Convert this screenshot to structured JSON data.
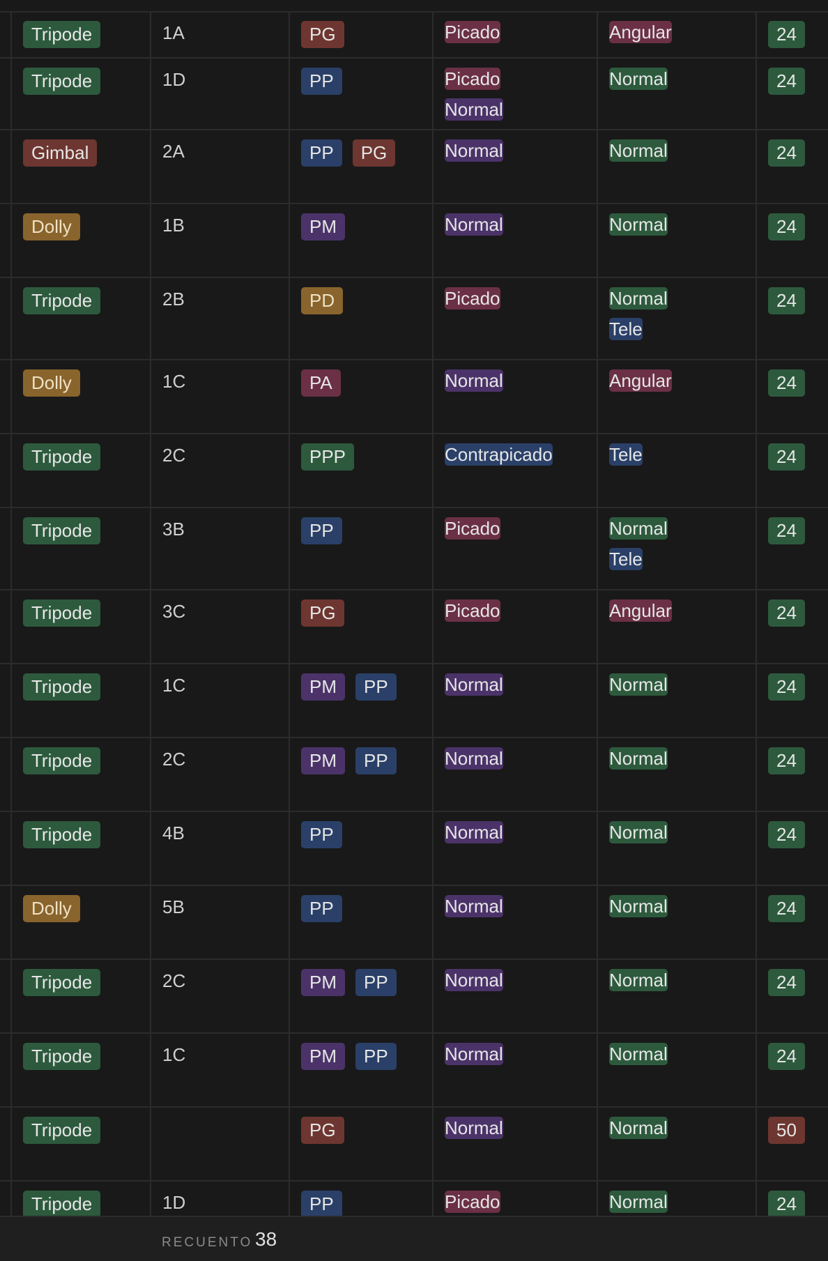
{
  "rows": [
    {
      "soporte": {
        "label": "Tripode",
        "color": "green"
      },
      "plano": "1A",
      "tipo": [
        {
          "label": "PG",
          "color": "red"
        }
      ],
      "angulo": [
        {
          "label": "Picado",
          "color": "pink"
        }
      ],
      "lente": [
        {
          "label": "Angular",
          "color": "pink"
        }
      ],
      "fps": {
        "label": "24",
        "color": "green"
      }
    },
    {
      "soporte": {
        "label": "Tripode",
        "color": "green"
      },
      "plano": "1D",
      "tipo": [
        {
          "label": "PP",
          "color": "blue"
        }
      ],
      "angulo": [
        {
          "label": "Picado",
          "color": "pink"
        },
        {
          "label": "Normal",
          "color": "purple"
        }
      ],
      "lente": [
        {
          "label": "Normal",
          "color": "green"
        }
      ],
      "fps": {
        "label": "24",
        "color": "green"
      }
    },
    {
      "soporte": {
        "label": "Gimbal",
        "color": "red"
      },
      "plano": "2A",
      "tipo": [
        {
          "label": "PP",
          "color": "blue"
        },
        {
          "label": "PG",
          "color": "red"
        }
      ],
      "angulo": [
        {
          "label": "Normal",
          "color": "purple"
        }
      ],
      "lente": [
        {
          "label": "Normal",
          "color": "green"
        }
      ],
      "fps": {
        "label": "24",
        "color": "green"
      }
    },
    {
      "soporte": {
        "label": "Dolly",
        "color": "yellow"
      },
      "plano": "1B",
      "tipo": [
        {
          "label": "PM",
          "color": "purple"
        }
      ],
      "angulo": [
        {
          "label": "Normal",
          "color": "purple"
        }
      ],
      "lente": [
        {
          "label": "Normal",
          "color": "green"
        }
      ],
      "fps": {
        "label": "24",
        "color": "green"
      }
    },
    {
      "soporte": {
        "label": "Tripode",
        "color": "green"
      },
      "plano": "2B",
      "tipo": [
        {
          "label": "PD",
          "color": "yellow"
        }
      ],
      "angulo": [
        {
          "label": "Picado",
          "color": "pink"
        }
      ],
      "lente": [
        {
          "label": "Normal",
          "color": "green"
        },
        {
          "label": "Tele",
          "color": "blue"
        }
      ],
      "fps": {
        "label": "24",
        "color": "green"
      }
    },
    {
      "soporte": {
        "label": "Dolly",
        "color": "yellow"
      },
      "plano": "1C",
      "tipo": [
        {
          "label": "PA",
          "color": "pink"
        }
      ],
      "angulo": [
        {
          "label": "Normal",
          "color": "purple"
        }
      ],
      "lente": [
        {
          "label": "Angular",
          "color": "pink"
        }
      ],
      "fps": {
        "label": "24",
        "color": "green"
      }
    },
    {
      "soporte": {
        "label": "Tripode",
        "color": "green"
      },
      "plano": "2C",
      "tipo": [
        {
          "label": "PPP",
          "color": "green"
        }
      ],
      "angulo": [
        {
          "label": "Contrapicado",
          "color": "blue"
        }
      ],
      "lente": [
        {
          "label": "Tele",
          "color": "blue"
        }
      ],
      "fps": {
        "label": "24",
        "color": "green"
      }
    },
    {
      "soporte": {
        "label": "Tripode",
        "color": "green"
      },
      "plano": "3B",
      "tipo": [
        {
          "label": "PP",
          "color": "blue"
        }
      ],
      "angulo": [
        {
          "label": "Picado",
          "color": "pink"
        }
      ],
      "lente": [
        {
          "label": "Normal",
          "color": "green"
        },
        {
          "label": "Tele",
          "color": "blue"
        }
      ],
      "fps": {
        "label": "24",
        "color": "green"
      }
    },
    {
      "soporte": {
        "label": "Tripode",
        "color": "green"
      },
      "plano": "3C",
      "tipo": [
        {
          "label": "PG",
          "color": "red"
        }
      ],
      "angulo": [
        {
          "label": "Picado",
          "color": "pink"
        }
      ],
      "lente": [
        {
          "label": "Angular",
          "color": "pink"
        }
      ],
      "fps": {
        "label": "24",
        "color": "green"
      }
    },
    {
      "soporte": {
        "label": "Tripode",
        "color": "green"
      },
      "plano": "1C",
      "tipo": [
        {
          "label": "PM",
          "color": "purple"
        },
        {
          "label": "PP",
          "color": "blue"
        }
      ],
      "angulo": [
        {
          "label": "Normal",
          "color": "purple"
        }
      ],
      "lente": [
        {
          "label": "Normal",
          "color": "green"
        }
      ],
      "fps": {
        "label": "24",
        "color": "green"
      }
    },
    {
      "soporte": {
        "label": "Tripode",
        "color": "green"
      },
      "plano": "2C",
      "tipo": [
        {
          "label": "PM",
          "color": "purple"
        },
        {
          "label": "PP",
          "color": "blue"
        }
      ],
      "angulo": [
        {
          "label": "Normal",
          "color": "purple"
        }
      ],
      "lente": [
        {
          "label": "Normal",
          "color": "green"
        }
      ],
      "fps": {
        "label": "24",
        "color": "green"
      }
    },
    {
      "soporte": {
        "label": "Tripode",
        "color": "green"
      },
      "plano": "4B",
      "tipo": [
        {
          "label": "PP",
          "color": "blue"
        }
      ],
      "angulo": [
        {
          "label": "Normal",
          "color": "purple"
        }
      ],
      "lente": [
        {
          "label": "Normal",
          "color": "green"
        }
      ],
      "fps": {
        "label": "24",
        "color": "green"
      }
    },
    {
      "soporte": {
        "label": "Dolly",
        "color": "yellow"
      },
      "plano": "5B",
      "tipo": [
        {
          "label": "PP",
          "color": "blue"
        }
      ],
      "angulo": [
        {
          "label": "Normal",
          "color": "purple"
        }
      ],
      "lente": [
        {
          "label": "Normal",
          "color": "green"
        }
      ],
      "fps": {
        "label": "24",
        "color": "green"
      }
    },
    {
      "soporte": {
        "label": "Tripode",
        "color": "green"
      },
      "plano": "2C",
      "tipo": [
        {
          "label": "PM",
          "color": "purple"
        },
        {
          "label": "PP",
          "color": "blue"
        }
      ],
      "angulo": [
        {
          "label": "Normal",
          "color": "purple"
        }
      ],
      "lente": [
        {
          "label": "Normal",
          "color": "green"
        }
      ],
      "fps": {
        "label": "24",
        "color": "green"
      }
    },
    {
      "soporte": {
        "label": "Tripode",
        "color": "green"
      },
      "plano": "1C",
      "tipo": [
        {
          "label": "PM",
          "color": "purple"
        },
        {
          "label": "PP",
          "color": "blue"
        }
      ],
      "angulo": [
        {
          "label": "Normal",
          "color": "purple"
        }
      ],
      "lente": [
        {
          "label": "Normal",
          "color": "green"
        }
      ],
      "fps": {
        "label": "24",
        "color": "green"
      }
    },
    {
      "soporte": {
        "label": "Tripode",
        "color": "green"
      },
      "plano": "",
      "tipo": [
        {
          "label": "PG",
          "color": "red"
        }
      ],
      "angulo": [
        {
          "label": "Normal",
          "color": "purple"
        }
      ],
      "lente": [
        {
          "label": "Normal",
          "color": "green"
        }
      ],
      "fps": {
        "label": "50",
        "color": "red"
      }
    },
    {
      "soporte": {
        "label": "Tripode",
        "color": "green"
      },
      "plano": "1D",
      "tipo": [
        {
          "label": "PP",
          "color": "blue"
        }
      ],
      "angulo": [
        {
          "label": "Picado",
          "color": "pink"
        }
      ],
      "lente": [
        {
          "label": "Normal",
          "color": "green"
        }
      ],
      "fps": {
        "label": "24",
        "color": "green"
      }
    }
  ],
  "footer": {
    "label": "RECUENTO",
    "value": "38"
  }
}
